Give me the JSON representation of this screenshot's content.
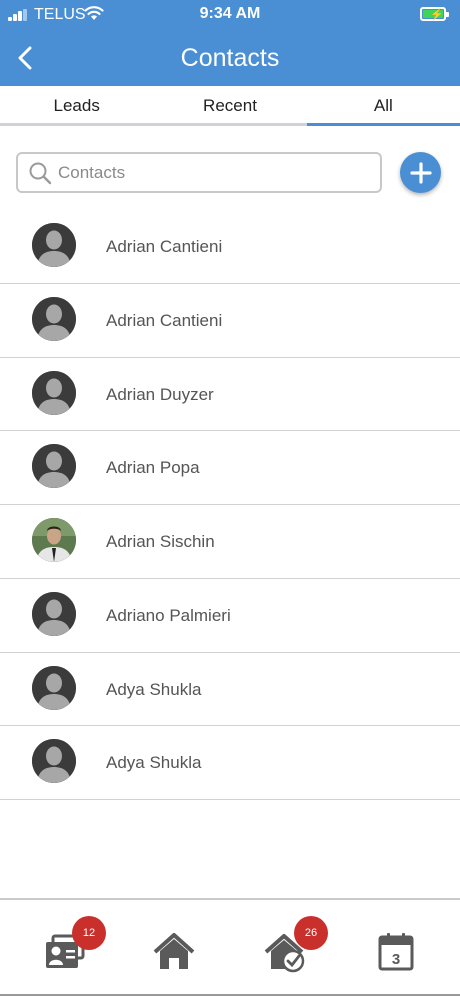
{
  "status_bar": {
    "carrier": "TELUS",
    "time": "9:34 AM"
  },
  "header": {
    "title": "Contacts",
    "back_icon": "chevron-left-icon"
  },
  "tabs": [
    {
      "label": "Leads",
      "active": false
    },
    {
      "label": "Recent",
      "active": false
    },
    {
      "label": "All",
      "active": true
    }
  ],
  "search": {
    "placeholder": "Contacts",
    "value": ""
  },
  "contacts": [
    {
      "name": "Adrian Cantieni",
      "avatar": "placeholder"
    },
    {
      "name": "Adrian Cantieni",
      "avatar": "placeholder"
    },
    {
      "name": "Adrian Duyzer",
      "avatar": "placeholder"
    },
    {
      "name": "Adrian Popa",
      "avatar": "placeholder"
    },
    {
      "name": "Adrian Sischin",
      "avatar": "photo"
    },
    {
      "name": "Adriano Palmieri",
      "avatar": "placeholder"
    },
    {
      "name": "Adya Shukla",
      "avatar": "placeholder"
    },
    {
      "name": "Adya Shukla",
      "avatar": "placeholder"
    }
  ],
  "bottom_nav": {
    "contacts_badge": "12",
    "listings_badge": "26",
    "calendar_day": "3"
  },
  "colors": {
    "accent": "#4a8fd4",
    "badge": "#c9302c",
    "nav_icon": "#5a5a5a"
  }
}
